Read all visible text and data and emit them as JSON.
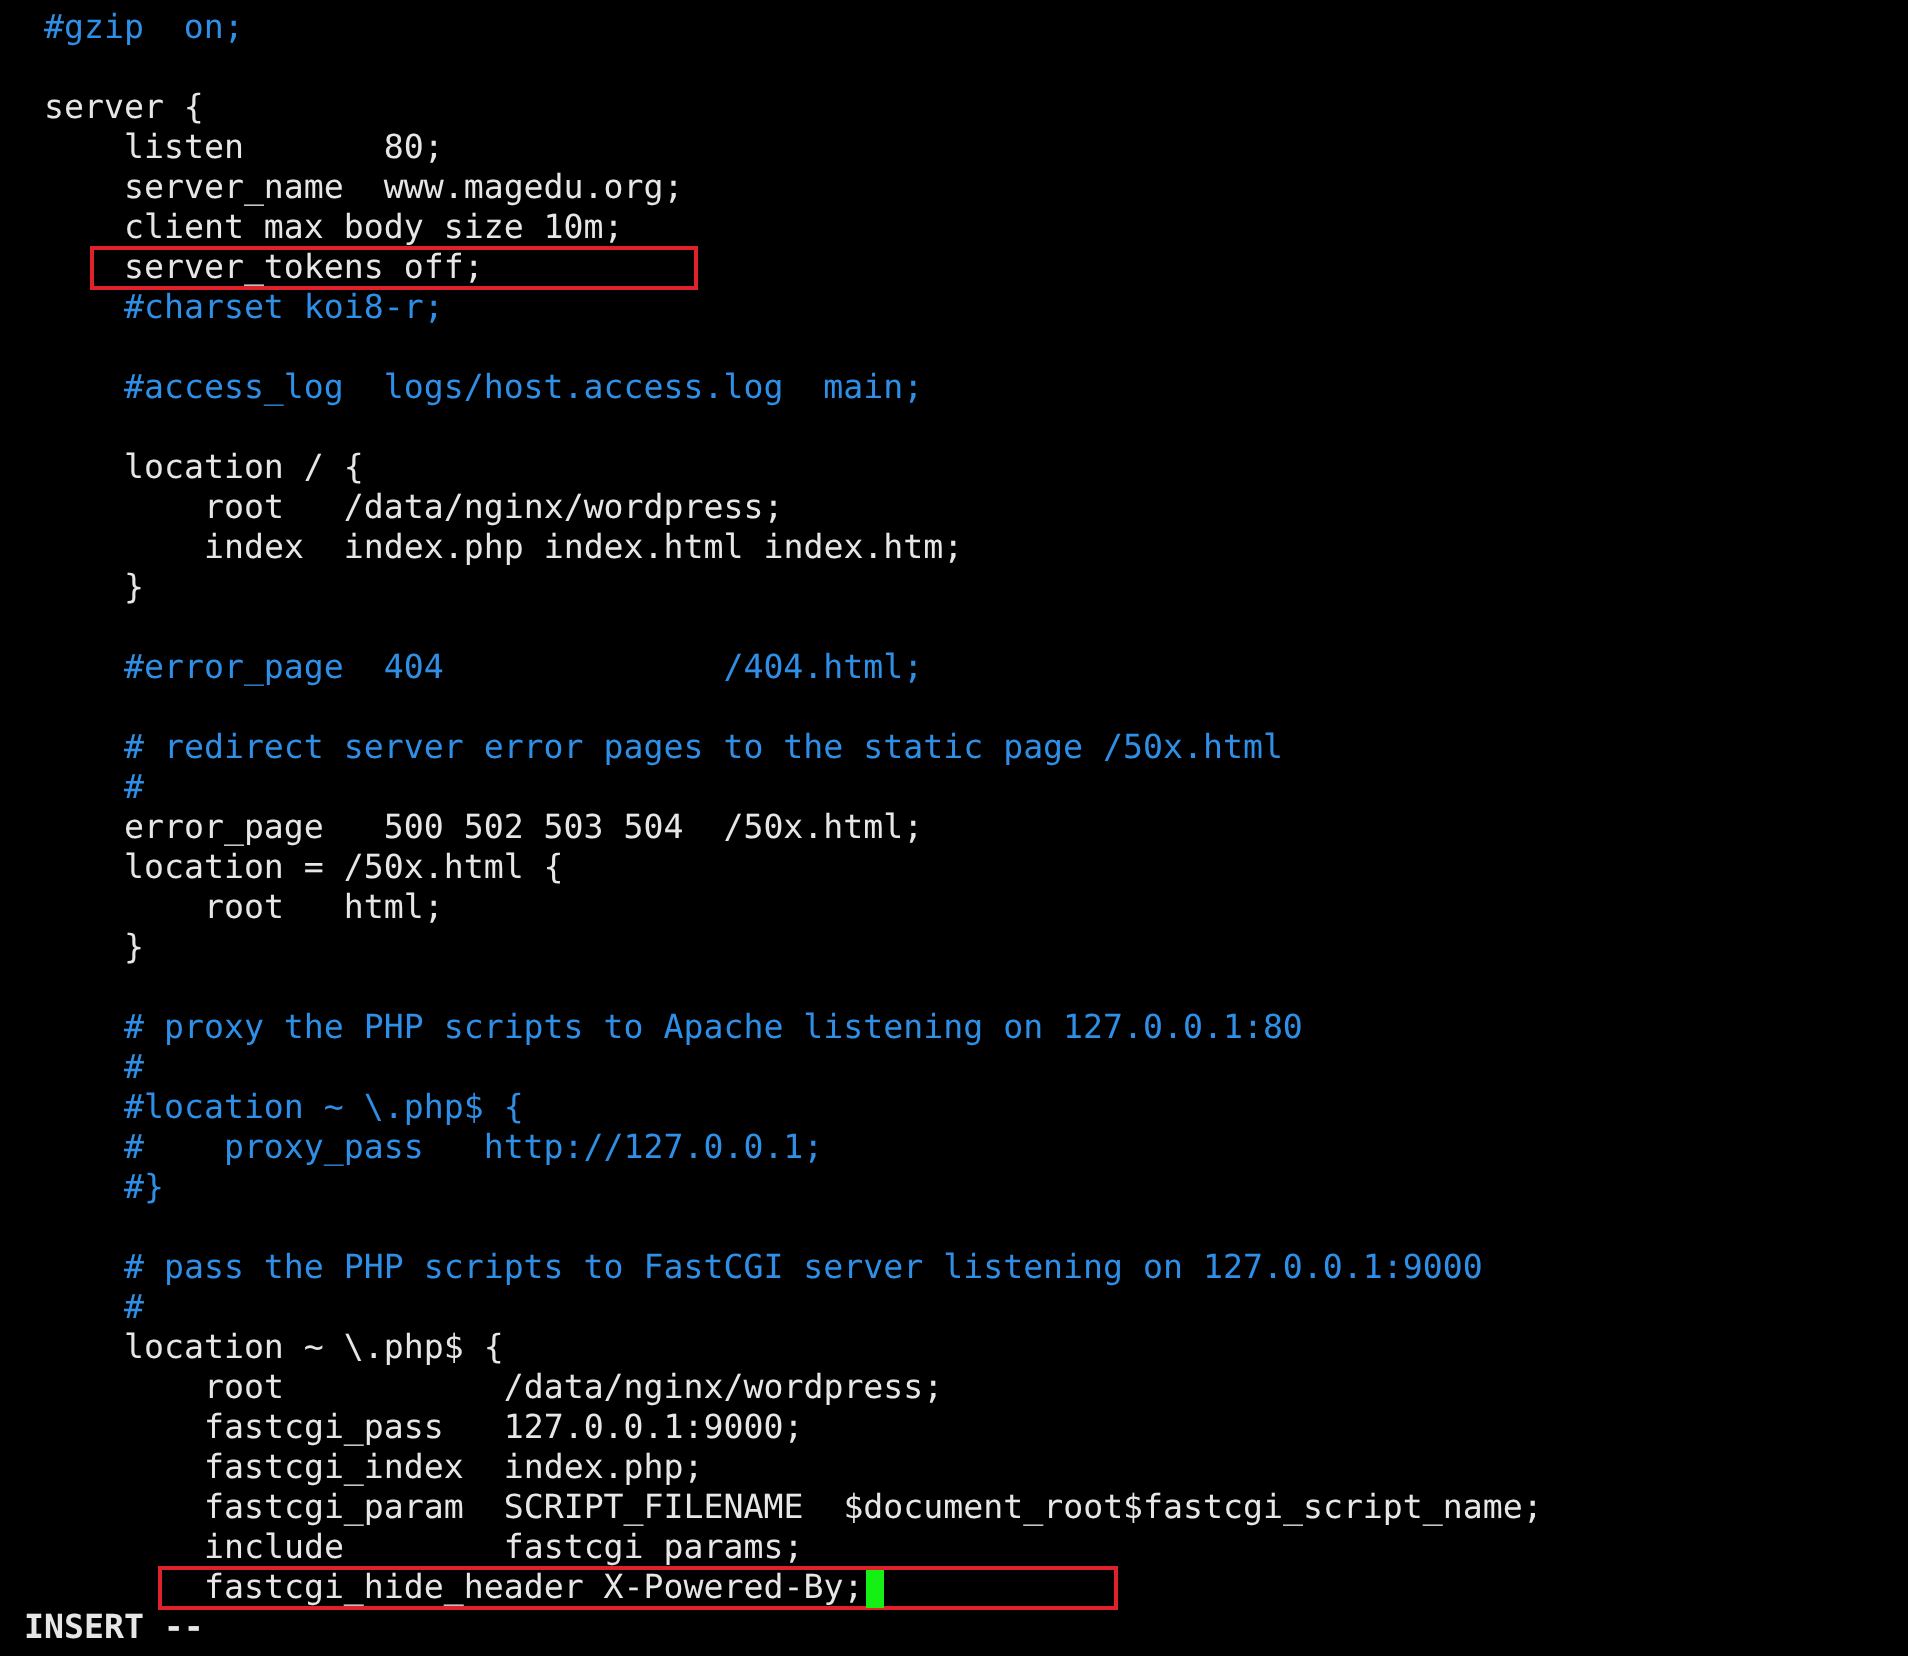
{
  "editor": {
    "lines": [
      {
        "kind": "comment",
        "text": "#gzip  on;",
        "boxed": false,
        "cursor": false
      },
      {
        "kind": "blank"
      },
      {
        "kind": "code",
        "text": "server {",
        "boxed": false,
        "cursor": false,
        "children": [
          {
            "kind": "code",
            "text": "listen       80;",
            "boxed": false,
            "cursor": false
          },
          {
            "kind": "code",
            "text": "server_name  www.magedu.org;",
            "boxed": false,
            "cursor": false
          },
          {
            "kind": "code",
            "text": "client max body size 10m;",
            "boxed": false,
            "cursor": false
          },
          {
            "kind": "code",
            "text": "server_tokens off;",
            "boxed": true,
            "cursor": false
          },
          {
            "kind": "comment",
            "text": "#charset koi8-r;",
            "boxed": false,
            "cursor": false
          },
          {
            "kind": "blank"
          },
          {
            "kind": "comment",
            "text": "#access_log  logs/host.access.log  main;",
            "boxed": false,
            "cursor": false
          },
          {
            "kind": "blank"
          },
          {
            "kind": "code",
            "text": "location / {",
            "boxed": false,
            "cursor": false,
            "children": [
              {
                "kind": "code",
                "text": "root   /data/nginx/wordpress;",
                "boxed": false,
                "cursor": false
              },
              {
                "kind": "code",
                "text": "index  index.php index.html index.htm;",
                "boxed": false,
                "cursor": false
              }
            ]
          },
          {
            "kind": "code",
            "text": "}",
            "boxed": false,
            "cursor": false
          },
          {
            "kind": "blank"
          },
          {
            "kind": "comment",
            "text": "#error_page  404              /404.html;",
            "boxed": false,
            "cursor": false
          },
          {
            "kind": "blank"
          },
          {
            "kind": "comment",
            "text": "# redirect server error pages to the static page /50x.html",
            "boxed": false,
            "cursor": false
          },
          {
            "kind": "comment",
            "text": "#",
            "boxed": false,
            "cursor": false
          },
          {
            "kind": "code",
            "text": "error_page   500 502 503 504  /50x.html;",
            "boxed": false,
            "cursor": false
          },
          {
            "kind": "code",
            "text": "location = /50x.html {",
            "boxed": false,
            "cursor": false,
            "children": [
              {
                "kind": "code",
                "text": "root   html;",
                "boxed": false,
                "cursor": false
              }
            ]
          },
          {
            "kind": "code",
            "text": "}",
            "boxed": false,
            "cursor": false
          },
          {
            "kind": "blank"
          },
          {
            "kind": "comment",
            "text": "# proxy the PHP scripts to Apache listening on 127.0.0.1:80",
            "boxed": false,
            "cursor": false
          },
          {
            "kind": "comment",
            "text": "#",
            "boxed": false,
            "cursor": false
          },
          {
            "kind": "comment",
            "text": "#location ~ \\.php$ {",
            "boxed": false,
            "cursor": false
          },
          {
            "kind": "comment",
            "text": "#    proxy_pass   http://127.0.0.1;",
            "boxed": false,
            "cursor": false
          },
          {
            "kind": "comment",
            "text": "#}",
            "boxed": false,
            "cursor": false
          },
          {
            "kind": "blank"
          },
          {
            "kind": "comment",
            "text": "# pass the PHP scripts to FastCGI server listening on 127.0.0.1:9000",
            "boxed": false,
            "cursor": false
          },
          {
            "kind": "comment",
            "text": "#",
            "boxed": false,
            "cursor": false
          },
          {
            "kind": "code",
            "text": "location ~ \\.php$ {",
            "boxed": false,
            "cursor": false,
            "children": [
              {
                "kind": "code",
                "text": "root           /data/nginx/wordpress;",
                "boxed": false,
                "cursor": false
              },
              {
                "kind": "code",
                "text": "fastcgi_pass   127.0.0.1:9000;",
                "boxed": false,
                "cursor": false
              },
              {
                "kind": "code",
                "text": "fastcgi_index  index.php;",
                "boxed": false,
                "cursor": false
              },
              {
                "kind": "code",
                "text": "fastcgi_param  SCRIPT_FILENAME  $document_root$fastcgi_script_name;",
                "boxed": false,
                "cursor": false
              },
              {
                "kind": "code",
                "text": "include        fastcgi params;",
                "boxed": false,
                "cursor": false
              },
              {
                "kind": "code",
                "text": "fastcgi_hide_header X-Powered-By;",
                "boxed": true,
                "cursor": true
              }
            ]
          }
        ]
      }
    ]
  },
  "status_bar": {
    "mode": "INSERT --"
  }
}
